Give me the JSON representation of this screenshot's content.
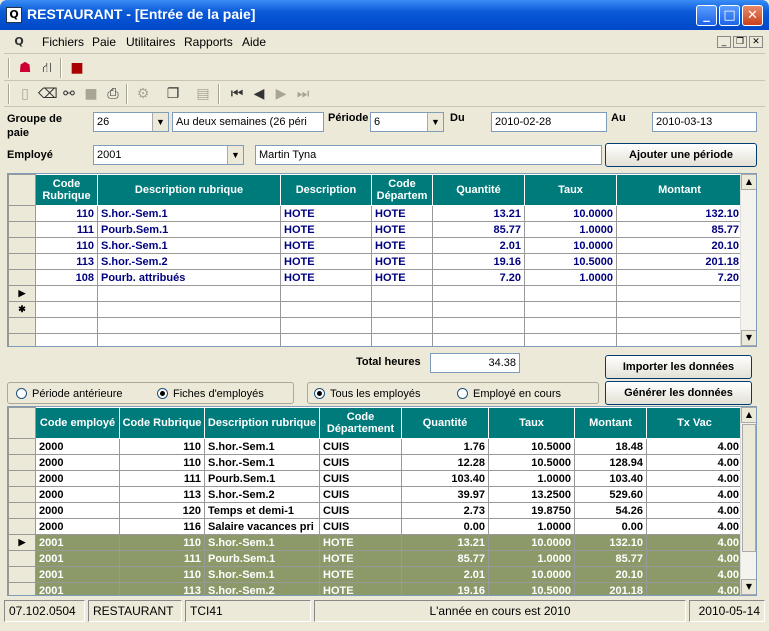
{
  "window": {
    "title": "RESTAURANT - [Entrée de la paie]",
    "app_icon": "Q"
  },
  "menu": [
    "Fichiers",
    "Paie",
    "Utilitaires",
    "Rapports",
    "Aide"
  ],
  "form": {
    "groupe_label": "Groupe de paie",
    "groupe_value": "26",
    "groupe_desc": "Au deux semaines (26 péri",
    "periode_label": "Période",
    "periode_value": "6",
    "du_label": "Du",
    "du_value": "2010-02-28",
    "au_label": "Au",
    "au_value": "2010-03-13",
    "employe_label": "Employé",
    "employe_value": "2001",
    "employe_name": "Martin Tyna",
    "add_period_button": "Ajouter une période"
  },
  "top_grid": {
    "headers": [
      "Code Rubrique",
      "Description rubrique",
      "Description",
      "Code Départem",
      "Quantité",
      "Taux",
      "Montant"
    ],
    "rows": [
      [
        "110",
        "S.hor.-Sem.1",
        "HOTE",
        "HOTE",
        "13.21",
        "10.0000",
        "132.10"
      ],
      [
        "111",
        "Pourb.Sem.1",
        "HOTE",
        "HOTE",
        "85.77",
        "1.0000",
        "85.77"
      ],
      [
        "110",
        "S.hor.-Sem.1",
        "HOTE",
        "HOTE",
        "2.01",
        "10.0000",
        "20.10"
      ],
      [
        "113",
        "S.hor.-Sem.2",
        "HOTE",
        "HOTE",
        "19.16",
        "10.5000",
        "201.18"
      ],
      [
        "108",
        "Pourb. attribués",
        "HOTE",
        "HOTE",
        "7.20",
        "1.0000",
        "7.20"
      ]
    ]
  },
  "total": {
    "label": "Total heures",
    "value": "34.38"
  },
  "import_button": "Importer les données",
  "generate_button": "Générer les données",
  "radios": {
    "periode_anterieure": "Période antérieure",
    "fiches_employes": "Fiches d'employés",
    "tous_employes": "Tous les employés",
    "employe_en_cours": "Employé en cours"
  },
  "bottom_grid": {
    "headers": [
      "Code employé",
      "Code Rubrique",
      "Description rubrique",
      "Code Département",
      "Quantité",
      "Taux",
      "Montant",
      "Tx Vac"
    ],
    "rows": [
      [
        "2000",
        "110",
        "S.hor.-Sem.1",
        "CUIS",
        "1.76",
        "10.5000",
        "18.48",
        "4.00"
      ],
      [
        "2000",
        "110",
        "S.hor.-Sem.1",
        "CUIS",
        "12.28",
        "10.5000",
        "128.94",
        "4.00"
      ],
      [
        "2000",
        "111",
        "Pourb.Sem.1",
        "CUIS",
        "103.40",
        "1.0000",
        "103.40",
        "4.00"
      ],
      [
        "2000",
        "113",
        "S.hor.-Sem.2",
        "CUIS",
        "39.97",
        "13.2500",
        "529.60",
        "4.00"
      ],
      [
        "2000",
        "120",
        "Temps et demi-1",
        "CUIS",
        "2.73",
        "19.8750",
        "54.26",
        "4.00"
      ],
      [
        "2000",
        "116",
        "Salaire vacances pri",
        "CUIS",
        "0.00",
        "1.0000",
        "0.00",
        "4.00"
      ],
      [
        "2001",
        "110",
        "S.hor.-Sem.1",
        "HOTE",
        "13.21",
        "10.0000",
        "132.10",
        "4.00"
      ],
      [
        "2001",
        "111",
        "Pourb.Sem.1",
        "HOTE",
        "85.77",
        "1.0000",
        "85.77",
        "4.00"
      ],
      [
        "2001",
        "110",
        "S.hor.-Sem.1",
        "HOTE",
        "2.01",
        "10.0000",
        "20.10",
        "4.00"
      ],
      [
        "2001",
        "113",
        "S.hor.-Sem.2",
        "HOTE",
        "19.16",
        "10.5000",
        "201.18",
        "4.00"
      ]
    ]
  },
  "status": [
    "07.102.0504",
    "RESTAURANT",
    "TCI41",
    "L'année en cours est 2010",
    "2010-05-14"
  ],
  "colors": {
    "header_teal": "#007b7b",
    "highlight_green": "#8c9a6a",
    "title_blue": "#0048c8"
  }
}
